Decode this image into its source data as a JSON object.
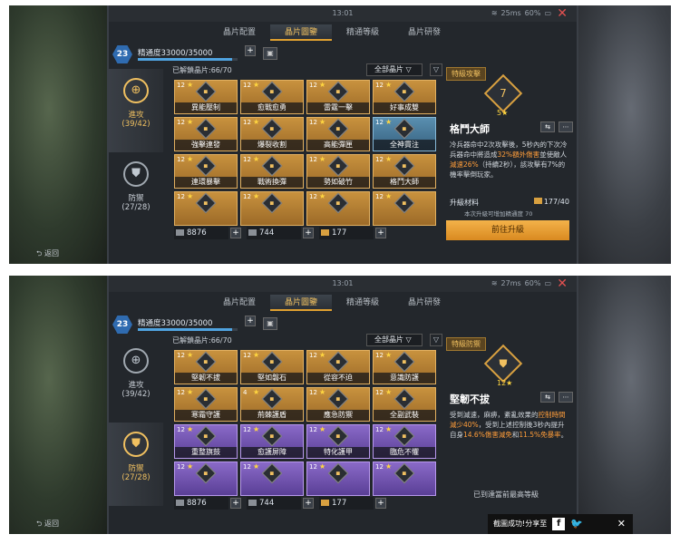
{
  "screens": [
    {
      "status": {
        "time": "13:01",
        "wifi": "25ms",
        "battery": "60%"
      },
      "tabs": [
        "晶片配置",
        "晶片圖鑒",
        "精通等級",
        "晶片研發"
      ],
      "level": "23",
      "proficiency": {
        "label": "精通度",
        "value": "33000/35000",
        "fill": 0.943
      },
      "sidebar": [
        {
          "label": "進攻",
          "count": "(39/42)"
        },
        {
          "label": "防禦",
          "count": "(27/28)"
        }
      ],
      "unlocked": "已解鎖晶片:66/70",
      "filter": "全部晶片",
      "cards": [
        {
          "lv": "12",
          "name": "異能壓制"
        },
        {
          "lv": "12",
          "name": "愈戰愈勇"
        },
        {
          "lv": "12",
          "name": "雷霆一擊"
        },
        {
          "lv": "12",
          "name": "好事成雙"
        },
        {
          "lv": "12",
          "name": "強擊連發"
        },
        {
          "lv": "12",
          "name": "爆裂收割"
        },
        {
          "lv": "12",
          "name": "高能彈匣"
        },
        {
          "lv": "12",
          "name": "全神貫注"
        },
        {
          "lv": "12",
          "name": "連環暴擊"
        },
        {
          "lv": "12",
          "name": "戰術換彈"
        },
        {
          "lv": "12",
          "name": "勢如破竹"
        },
        {
          "lv": "12",
          "name": "格鬥大師"
        },
        {
          "lv": "12",
          "name": ""
        },
        {
          "lv": "12",
          "name": ""
        },
        {
          "lv": "12",
          "name": ""
        },
        {
          "lv": "12",
          "name": ""
        }
      ],
      "resources": [
        "8876",
        "744",
        "177"
      ],
      "detail": {
        "tag": "特級攻擊",
        "chip_level": "7",
        "stars": "5★",
        "name": "格鬥大師",
        "desc": [
          "冷兵器命中2次攻擊後，5秒內的下次冷兵器命中將造成",
          "32%額外傷害",
          "並使敵人",
          "減速26%",
          "（持續2秒），該攻擊有7%的機率擊倒玩家。"
        ],
        "mat_label": "升級材料",
        "mat_value": "177/40",
        "mat_note": "本次升級可增加精通度",
        "mat_note_value": "70",
        "upgrade": "前往升級"
      },
      "back": "返回"
    },
    {
      "status": {
        "time": "13:01",
        "wifi": "27ms",
        "battery": "60%"
      },
      "tabs": [
        "晶片配置",
        "晶片圖鑒",
        "精通等級",
        "晶片研發"
      ],
      "level": "23",
      "proficiency": {
        "label": "精通度",
        "value": "33000/35000",
        "fill": 0.943
      },
      "sidebar": [
        {
          "label": "進攻",
          "count": "(39/42)"
        },
        {
          "label": "防禦",
          "count": "(27/28)"
        }
      ],
      "unlocked": "已解鎖晶片:66/70",
      "filter": "全部晶片",
      "cards": [
        {
          "lv": "12",
          "name": "堅韌不拔"
        },
        {
          "lv": "12",
          "name": "堅如磐石"
        },
        {
          "lv": "12",
          "name": "從容不迫"
        },
        {
          "lv": "12",
          "name": "意識防護"
        },
        {
          "lv": "12",
          "name": "寒霜守護"
        },
        {
          "lv": "4",
          "name": "荊棘護盾"
        },
        {
          "lv": "12",
          "name": "應急防禦"
        },
        {
          "lv": "12",
          "name": "全副武裝"
        },
        {
          "lv": "12",
          "name": "重整旗鼓"
        },
        {
          "lv": "12",
          "name": "愈護屏障"
        },
        {
          "lv": "12",
          "name": "特化護甲"
        },
        {
          "lv": "12",
          "name": "臨危不懼"
        },
        {
          "lv": "12",
          "name": ""
        },
        {
          "lv": "12",
          "name": ""
        },
        {
          "lv": "12",
          "name": ""
        },
        {
          "lv": "12",
          "name": ""
        }
      ],
      "resources": [
        "8876",
        "744",
        "177"
      ],
      "detail": {
        "tag": "特級防禦",
        "chip_level": "",
        "stars": "12★",
        "name": "堅韌不拔",
        "desc": [
          "受到減速，麻痹，紊亂效果的",
          "控制時間減少40%",
          "，受到上述控制後3秒內提升自身",
          "14.6%傷害減免",
          "和",
          "11.5%免暴率",
          "。"
        ],
        "maxed": "已到達當前最高等級"
      },
      "back": "返回"
    }
  ],
  "toast": {
    "text": "截圖成功!分享至",
    "fb": "f"
  },
  "icons": [
    "wifi-icon",
    "battery-icon",
    "close-icon",
    "shield-icon",
    "crosshair-icon",
    "filter-icon",
    "share-icon",
    "more-icon",
    "back-icon",
    "facebook-icon",
    "twitter-icon"
  ]
}
